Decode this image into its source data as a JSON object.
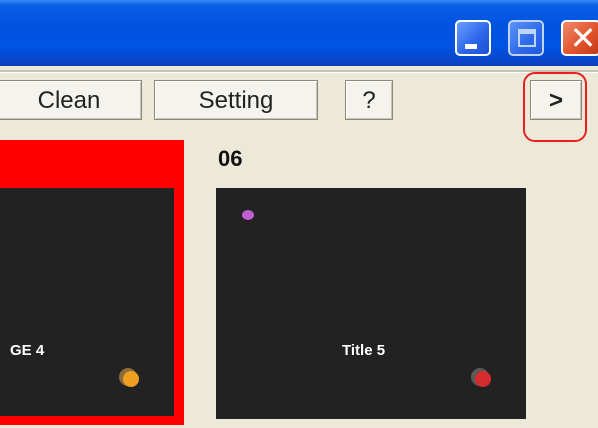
{
  "window": {
    "buttons": {
      "minimize": "minimize",
      "maximize": "maximize",
      "close": "close"
    }
  },
  "toolbar": {
    "clean_label": "Clean",
    "setting_label": "Setting",
    "help_label": "?",
    "next_label": ">"
  },
  "tiles": [
    {
      "number": "",
      "title": "GE 4",
      "selected": true,
      "badge_color": "#f0a020"
    },
    {
      "number": "06",
      "title": "Title 5",
      "selected": false,
      "badge_color": "#d62c2c",
      "top_badge_color": "#c060d0"
    }
  ],
  "colors": {
    "selection": "#ff0000",
    "tile_bg": "#222222",
    "titlebar": "#0054e3",
    "highlight": "#e82020"
  }
}
